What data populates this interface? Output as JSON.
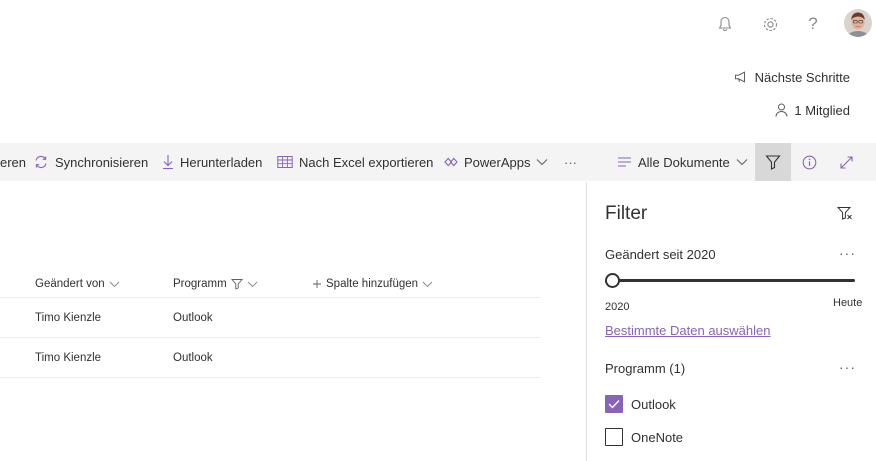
{
  "suite": {
    "icons": [
      "bell-icon",
      "gear-icon",
      "help-icon"
    ],
    "help_glyph": "?"
  },
  "site": {
    "next_steps": "Nächste Schritte",
    "members": "1 Mitglied"
  },
  "commands": {
    "truncated_label": "eren",
    "sync": "Synchronisieren",
    "download": "Herunterladen",
    "export_excel": "Nach Excel exportieren",
    "powerapps": "PowerApps",
    "more": "···",
    "view": "Alle Dokumente"
  },
  "list": {
    "columns": {
      "modified_by": "Geändert von",
      "program": "Programm",
      "add_column": "Spalte hinzufügen"
    },
    "rows": [
      {
        "modified_by": "Timo Kienzle",
        "program": "Outlook"
      },
      {
        "modified_by": "Timo Kienzle",
        "program": "Outlook"
      }
    ]
  },
  "filter_pane": {
    "title": "Filter",
    "modified_section": "Geändert seit 2020",
    "more": "···",
    "slider_min": "2020",
    "slider_max": "Heute",
    "slider_value_fraction": 0,
    "specific_dates_link": "Bestimmte Daten auswählen",
    "program_section": "Programm (1)",
    "options": [
      {
        "label": "Outlook",
        "checked": true
      },
      {
        "label": "OneNote",
        "checked": false
      }
    ]
  },
  "colors": {
    "accent": "#8764b8",
    "command_bar_bg": "#f4f4f4",
    "active_filter_bg": "#d8d8d8"
  }
}
